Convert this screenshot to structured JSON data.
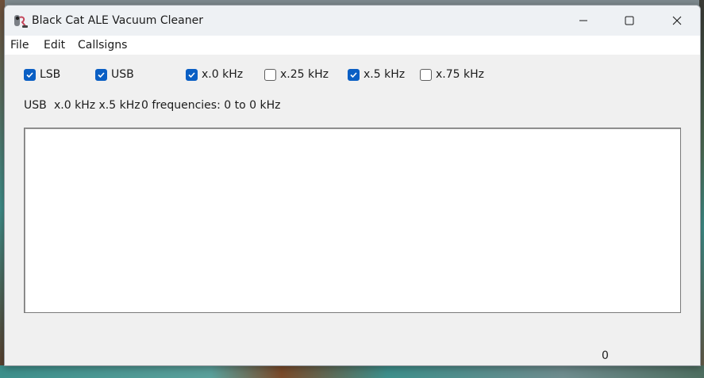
{
  "window": {
    "title": "Black Cat ALE Vacuum Cleaner"
  },
  "icons": {
    "app": "vacuum-cleaner-app-icon",
    "minimize": "minimize-icon",
    "maximize": "maximize-icon",
    "close": "close-icon",
    "check": "checkmark-icon"
  },
  "menu": {
    "file": "File",
    "edit": "Edit",
    "callsigns": "Callsigns"
  },
  "filters": [
    {
      "label": "LSB",
      "checked": true
    },
    {
      "label": "USB",
      "checked": true
    },
    {
      "label": "x.0 kHz",
      "checked": true
    },
    {
      "label": "x.25 kHz",
      "checked": false
    },
    {
      "label": "x.5 kHz",
      "checked": true
    },
    {
      "label": "x.75 kHz",
      "checked": false
    }
  ],
  "status": {
    "mode": "USB",
    "offsets": "x.0 kHz x.5 kHz",
    "summary": "0 frequencies: 0 to 0 kHz"
  },
  "footer": {
    "count": "0"
  },
  "colors": {
    "checkbox_on": "#0a5fc4",
    "window_bg": "#f0f0f0",
    "menubar_bg": "#ffffff"
  }
}
